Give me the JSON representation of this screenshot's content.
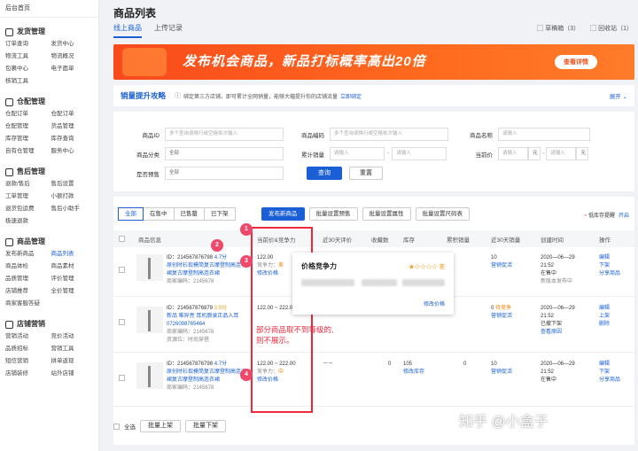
{
  "sidebar": {
    "home": "后台首页",
    "sections": [
      {
        "title": "发货管理",
        "items": [
          "订单查询",
          "发货中心",
          "物流工具",
          "物流概况",
          "包裹中心",
          "电子面单",
          "核销工具"
        ]
      },
      {
        "title": "仓配管理",
        "items": [
          "仓配订单",
          "仓配订单",
          "仓配管理",
          "货品管理",
          "库存管理",
          "库存查询",
          "自有仓管理",
          "服务中心"
        ]
      },
      {
        "title": "售后管理",
        "items": [
          "退款/售后",
          "售后设置",
          "工单管理",
          "小额打款",
          "退货包运费",
          "售后小助手",
          "极速退款"
        ]
      },
      {
        "title": "商品管理",
        "items": [
          "发布新商品",
          "商品列表",
          "商品体检",
          "商品素材",
          "品质管理",
          "评价管理",
          "店铺推荐",
          "全价管理",
          "商家客服答疑"
        ]
      },
      {
        "title": "店铺营销",
        "items": [
          "营销活动",
          "竞价活动",
          "品质招标",
          "营销工具",
          "短信营销",
          "拼单返现",
          "店铺装修",
          "站外店铺"
        ]
      }
    ],
    "active_item": "商品列表"
  },
  "header": {
    "title": "商品列表",
    "tabs": [
      "线上商品",
      "上传记录"
    ],
    "active_tab": "线上商品",
    "drafts": "草稿箱（3）",
    "recycle": "回收站（1）"
  },
  "banner": {
    "text": "发布机会商品，新品打标概率高出20倍",
    "button": "查看详情"
  },
  "tip": {
    "title": "销量提升攻略",
    "desc": "绑定第三方店铺，即可累计全网销量，能够大幅提升你的店铺流量",
    "link": "立即绑定",
    "expand": "展开 ⌄"
  },
  "filter": {
    "product_id_label": "商品ID",
    "product_id_ph": "多个查询请换行或空格依次输入",
    "product_code_label": "商品编码",
    "product_code_ph": "多个查询请换行或空格依次输入",
    "product_name_label": "商品名称",
    "product_name_ph": "请输入",
    "category_label": "商品分类",
    "category_value": "全部",
    "sales_label": "累计销量",
    "sales_ph1": "请输入",
    "sales_ph2": "请输入",
    "price_label": "当前价",
    "price_ph1": "请输入",
    "price_unit": "元",
    "price_ph2": "请输入",
    "presale_label": "是否预售",
    "presale_value": "全部",
    "search_btn": "查询",
    "reset_btn": "重置"
  },
  "list": {
    "segments": [
      "全部",
      "在售中",
      "已售罄",
      "已下架"
    ],
    "active_segment": "全部",
    "actions": [
      "发布新商品",
      "批量设置预售",
      "批量设置属性",
      "批量设置尺码表"
    ],
    "low_stock": "低库存提醒",
    "low_stock_toggle": "开启",
    "columns": [
      "商品信息",
      "当前价&竞争力",
      "近30天评价",
      "收藏数",
      "库存",
      "累积销量",
      "近30天销量",
      "创建时间",
      "操作"
    ],
    "rows": [
      {
        "id": "ID：214567876798",
        "score": "4.7分",
        "name": "原创时衫现模简复古摩登制高连衣裙复古摩登制高连衣裙",
        "code": "商家编码：2145678",
        "price": "122.00",
        "comp": "竞争力：",
        "comp_level": "差",
        "edit": "修改价格",
        "sales30": "10",
        "promo": "营销促活",
        "date": "2020—06—29",
        "time": "21:52",
        "status": "在售中",
        "status2": "新版本发布中",
        "ops": [
          "编辑",
          "下架",
          "分享商品"
        ]
      },
      {
        "id": "ID：214567876879",
        "score": "3.5分",
        "name": "新品 唯异亮 耳机廓录正品入耳0726098765464",
        "code": "商家编码：2145678",
        "res": "资源位：时尚穿搭",
        "price": "122.00 ~ 222.00",
        "comp": "竞争力：",
        "comp_level": "差",
        "edit": "修改价格",
        "stock_status": "待竞争",
        "sales30": "0",
        "promo": "营销促活",
        "date": "2020—06—29",
        "time": "21:52",
        "status": "已撤下架",
        "status2": "查看原因",
        "ops": [
          "编辑",
          "上架",
          "删除"
        ]
      },
      {
        "id": "ID：214567876798",
        "score": "4.7分",
        "name": "原创时衫现模简复古摩登制高连衣裙复古摩登制高连衣裙",
        "code": "商家编码：2145678",
        "price": "122.00 ~ 222.00",
        "comp": "竞争力：",
        "comp_level": "中",
        "edit": "修改价格",
        "reviews": "－－",
        "favs": "0",
        "stock": "105",
        "stock_edit": "修改库存",
        "total_sales": "0",
        "sales30": "10",
        "promo": "营销促活",
        "date": "2020—06—29",
        "time": "21:52",
        "status": "在售中",
        "ops": [
          "编辑",
          "下架",
          "分享商品"
        ]
      }
    ],
    "row1_extra": {
      "favs": "",
      "stock": ""
    },
    "popup": {
      "title": "价格竞争力",
      "stars": "★☆☆☆☆ 差",
      "edit": "修改价格"
    },
    "note": [
      "部分商品取不到等级的,",
      "则不展示。"
    ],
    "badges": [
      "1",
      "2",
      "3",
      "4"
    ],
    "select_all": "全选",
    "bulk_on": "批量上架",
    "bulk_off": "批量下架"
  },
  "watermark": "知乎 @小盒子",
  "colors": {
    "accent": "#1a5fd6",
    "banner": "#f94a1c",
    "highlight": "#f0283c"
  }
}
